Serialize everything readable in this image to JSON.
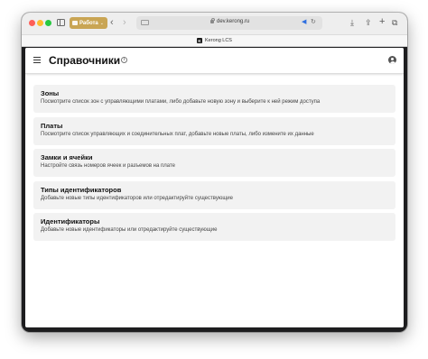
{
  "browser": {
    "tab_group_label": "Работа",
    "url": "dev.kerong.ru",
    "tab_title": "Kerong LCS",
    "tab_favicon": "K"
  },
  "app": {
    "page_title": "Справочники",
    "info_icon_glyph": "i"
  },
  "cards": [
    {
      "title": "Зоны",
      "description": "Посмотрите список зон с управляющими платами, либо добавьте новую зону и выберите к ней режим доступа"
    },
    {
      "title": "Платы",
      "description": "Посмотрите список управляющих и соединительных плат, добавьте новые платы, либо измените их данные"
    },
    {
      "title": "Замки и ячейки",
      "description": "Настройте связь номеров ячеек и разъемов на плате"
    },
    {
      "title": "Типы идентификаторов",
      "description": "Добавьте новые типы идентификаторов или отредактируйте существующие"
    },
    {
      "title": "Идентификаторы",
      "description": "Добавьте новые идентификаторы или отредактируйте существующие"
    }
  ],
  "icons": {
    "back": "‹",
    "forward": "›",
    "download": "⤓",
    "share": "⇪",
    "new_tab": "+",
    "tabs": "⧉",
    "speaker": "◀",
    "reload": "↻",
    "chevron": "⌄"
  },
  "colors": {
    "tab_group": "#c9a554",
    "window_frame": "#1d1d1f",
    "card_background": "#f2f2f2"
  }
}
